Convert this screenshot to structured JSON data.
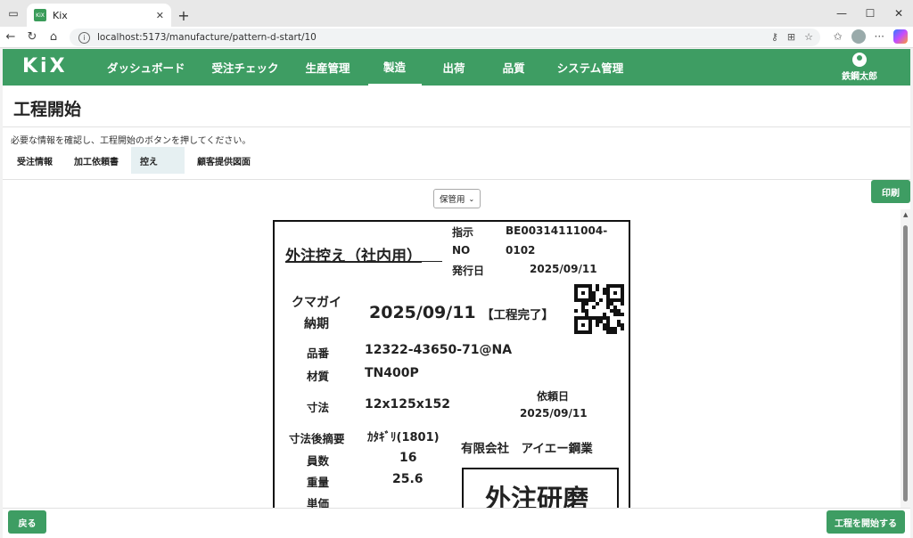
{
  "browser": {
    "tab_title": "Kix",
    "favicon_text": "KiX",
    "url": "localhost:5173/manufacture/pattern-d-start/10"
  },
  "header": {
    "logo": "KiX",
    "nav": [
      {
        "label": "ダッシュボード"
      },
      {
        "label": "受注チェック"
      },
      {
        "label": "生産管理"
      },
      {
        "label": "製造",
        "active": true
      },
      {
        "label": "出荷"
      },
      {
        "label": "品質"
      },
      {
        "label": "システム管理"
      }
    ],
    "user_name": "鉄鋼太郎"
  },
  "page": {
    "title": "工程開始",
    "instruction": "必要な情報を確認し、工程開始のボタンを押してください。",
    "tabs": [
      {
        "label": "受注情報"
      },
      {
        "label": "加工依頼書"
      },
      {
        "label": "控え",
        "active": true
      },
      {
        "label": "顧客提供図面"
      }
    ],
    "print_label": "印刷",
    "copy_select_value": "保管用"
  },
  "document": {
    "title": "外注控え（社内用）",
    "instruction_no_label_1": "指示",
    "instruction_no_label_2": "NO",
    "instruction_no_value_1": "BE00314111004-",
    "instruction_no_value_2": "0102",
    "issue_date_label": "発行日",
    "issue_date": "2025/09/11",
    "customer_label": "クマガイ",
    "due_label": "納期",
    "due_date": "2025/09/11",
    "process_status": "【工程完了】",
    "part_no_label": "品番",
    "part_no": "12322-43650-71@NA",
    "material_label": "材質",
    "material": "TN400P",
    "size_label": "寸法",
    "size": "12x125x152",
    "request_date_label": "依頼日",
    "request_date": "2025/09/11",
    "size_summary_label": "寸法後摘要",
    "size_summary": "ｶﾀｷﾞﾘ(1801)",
    "vendor": "有限会社　アイエー鋼業",
    "quantity_label": "員数",
    "quantity": "16",
    "weight_label": "重量",
    "weight": "25.6",
    "unit_price_label": "単価",
    "outsource_type": "外注研磨"
  },
  "footer": {
    "back_label": "戻る",
    "start_label": "工程を開始する"
  },
  "colors": {
    "brand": "#3e9d63",
    "active_tab_bg": "#e6f0f2"
  }
}
